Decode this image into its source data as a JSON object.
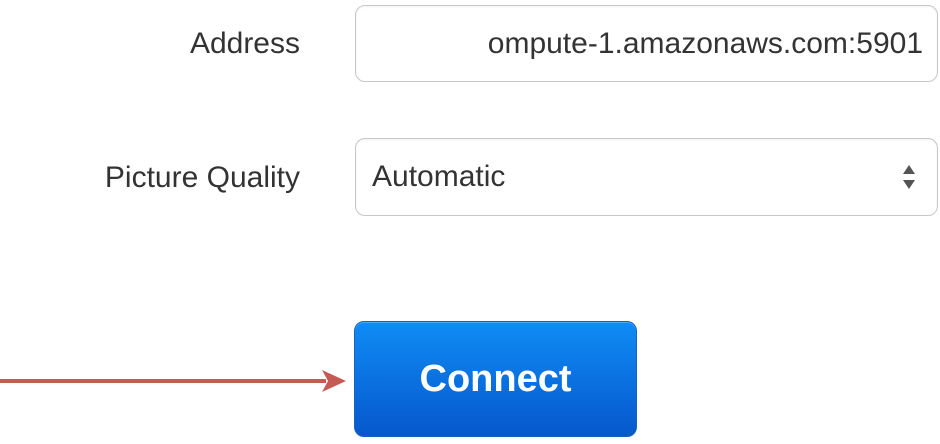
{
  "address": {
    "label": "Address",
    "value": "ompute-1.amazonaws.com:5901"
  },
  "picture_quality": {
    "label": "Picture Quality",
    "selected": "Automatic"
  },
  "actions": {
    "connect_label": "Connect"
  },
  "colors": {
    "connect_button": "#0a6fdf",
    "annotation_arrow": "#c65a54",
    "label_text": "#333333"
  },
  "icons": {
    "select_arrows": "updown-arrows-icon",
    "annotation": "pointer-arrow-icon"
  }
}
